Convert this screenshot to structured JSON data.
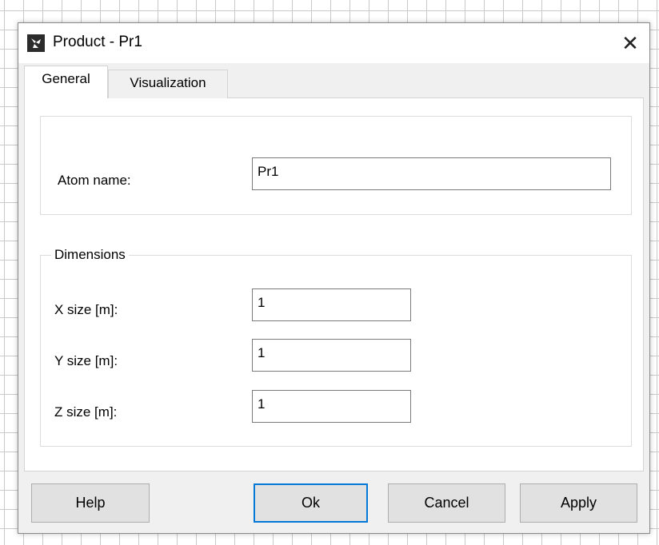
{
  "window": {
    "title": "Product - Pr1",
    "close_symbol": "✕",
    "icon": "app-icon"
  },
  "tabs": [
    {
      "label": "General",
      "active": true
    },
    {
      "label": "Visualization",
      "active": false
    }
  ],
  "general": {
    "atom_name": {
      "label": "Atom name:",
      "value": "Pr1"
    },
    "dimensions": {
      "legend": "Dimensions",
      "fields": [
        {
          "label": "X size [m]:",
          "value": "1"
        },
        {
          "label": "Y size [m]:",
          "value": "1"
        },
        {
          "label": "Z size [m]:",
          "value": "1"
        }
      ]
    }
  },
  "buttons": {
    "help": "Help",
    "ok": "Ok",
    "cancel": "Cancel",
    "apply": "Apply"
  },
  "colors": {
    "dialog_bg": "#f0f0f0",
    "default_button_border": "#0078d7"
  }
}
